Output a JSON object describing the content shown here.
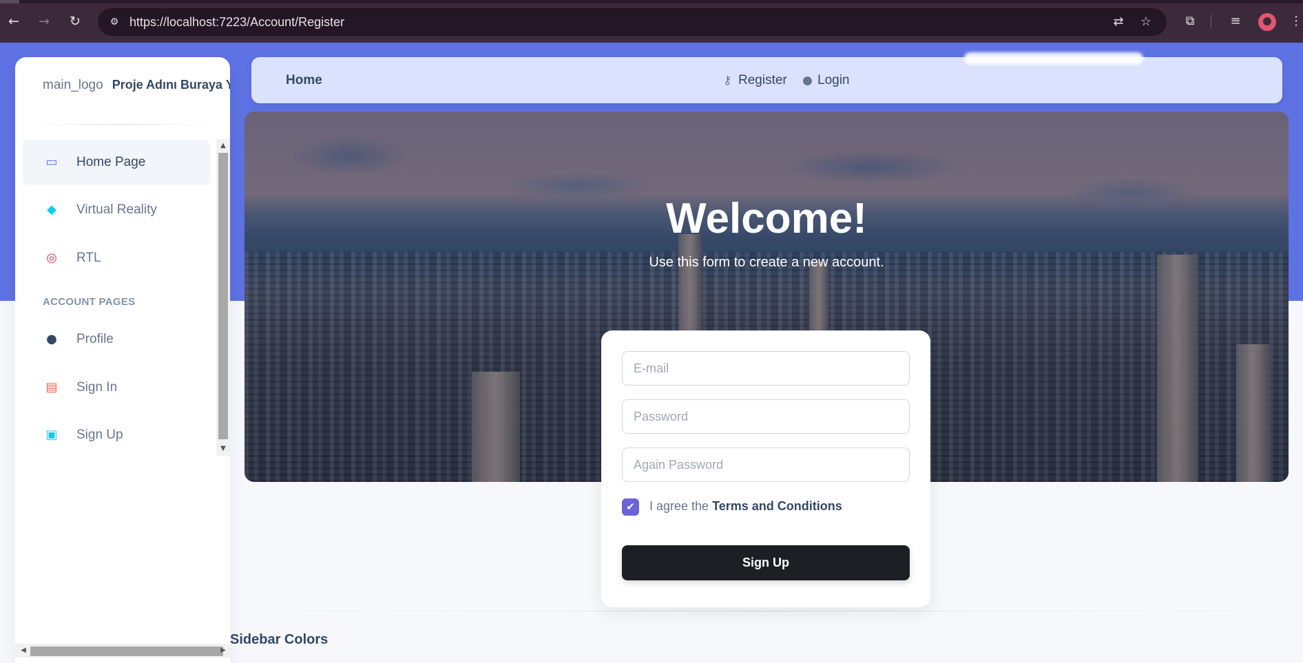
{
  "browser": {
    "url": "https://localhost:7223/Account/Register",
    "back_icon": "arrow-left",
    "forward_icon": "arrow-right",
    "reload_icon": "reload"
  },
  "sidebar": {
    "logo_alt": "main_logo",
    "project_name": "Proje Adını Buraya Ya",
    "items": [
      {
        "label": "Home Page",
        "icon": "monitor-icon",
        "color": "#5e72e4"
      },
      {
        "label": "Virtual Reality",
        "icon": "cube-icon",
        "color": "#11cdef"
      },
      {
        "label": "RTL",
        "icon": "globe-icon",
        "color": "#f5365c"
      }
    ],
    "section_title": "ACCOUNT PAGES",
    "account_items": [
      {
        "label": "Profile",
        "icon": "user-icon",
        "color": "#344767"
      },
      {
        "label": "Sign In",
        "icon": "document-icon",
        "color": "#fb6340"
      },
      {
        "label": "Sign Up",
        "icon": "collection-icon",
        "color": "#11cdef"
      }
    ]
  },
  "topnav": {
    "home": "Home",
    "register": "Register",
    "login": "Login"
  },
  "hero": {
    "title": "Welcome!",
    "subtitle": "Use this form to create a new account."
  },
  "form": {
    "email_placeholder": "E-mail",
    "password_placeholder": "Password",
    "again_password_placeholder": "Again Password",
    "agree_prefix": "I agree the ",
    "terms": "Terms and Conditions",
    "agree_checked": true,
    "submit": "Sign Up"
  },
  "footer": {
    "sidebar_colors": "Sidebar Colors"
  },
  "colors": {
    "primary": "#5e72e4",
    "dark_button": "#1d1f25",
    "checkbox": "#6c63d8"
  }
}
